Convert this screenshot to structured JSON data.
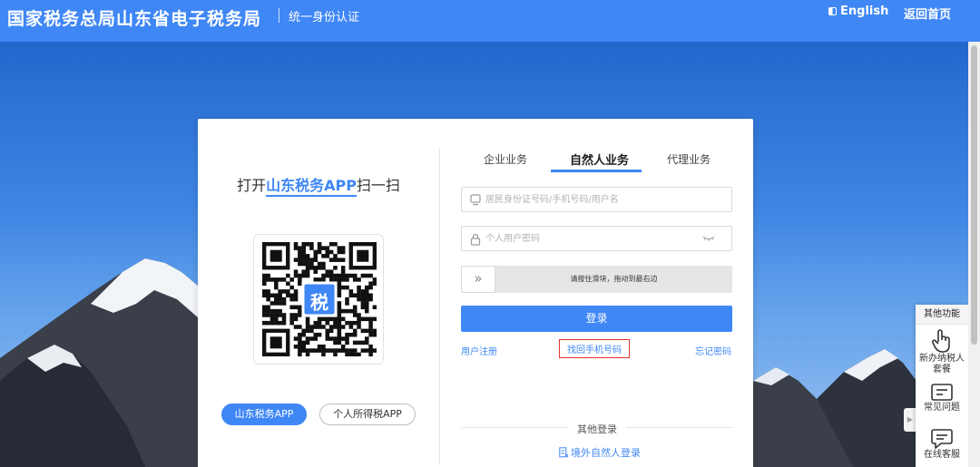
{
  "header": {
    "site_title": "国家税务总局山东省电子税务局",
    "subtitle": "统一身份认证",
    "language_label": "English",
    "home_label": "返回首页"
  },
  "qr_panel": {
    "scan_prefix": "打开",
    "scan_app": "山东税务APP",
    "scan_suffix": "扫一扫",
    "qr_center_glyph": "税",
    "app_buttons": [
      "山东税务APP",
      "个人所得税APP"
    ]
  },
  "tabs": [
    {
      "label": "企业业务",
      "active": false
    },
    {
      "label": "自然人业务",
      "active": true
    },
    {
      "label": "代理业务",
      "active": false
    }
  ],
  "form": {
    "account_placeholder": "居民身份证号码/手机号码/用户名",
    "password_placeholder": "个人用户密码",
    "slider_hint": "请按住滑块，拖动到最右边",
    "slider_handle_glyph": "»",
    "login_label": "登录",
    "links": {
      "register": "用户注册",
      "recover_phone": "找回手机号码",
      "forgot_password": "忘记密码"
    }
  },
  "other_login": {
    "label": "其他登录",
    "overseas": "境外自然人登录"
  },
  "side_panel": {
    "title": "其他功能",
    "items": [
      {
        "label": "新办纳税人套餐",
        "icon": "hand-pointer-icon"
      },
      {
        "label": "常见问题",
        "icon": "faq-card-icon"
      },
      {
        "label": "在线客服",
        "icon": "chat-bubble-icon"
      }
    ],
    "collapse_glyph": "▶"
  },
  "colors": {
    "accent": "#3f87f5",
    "highlight_border": "#e0342f",
    "card_bg": "#ffffff"
  }
}
